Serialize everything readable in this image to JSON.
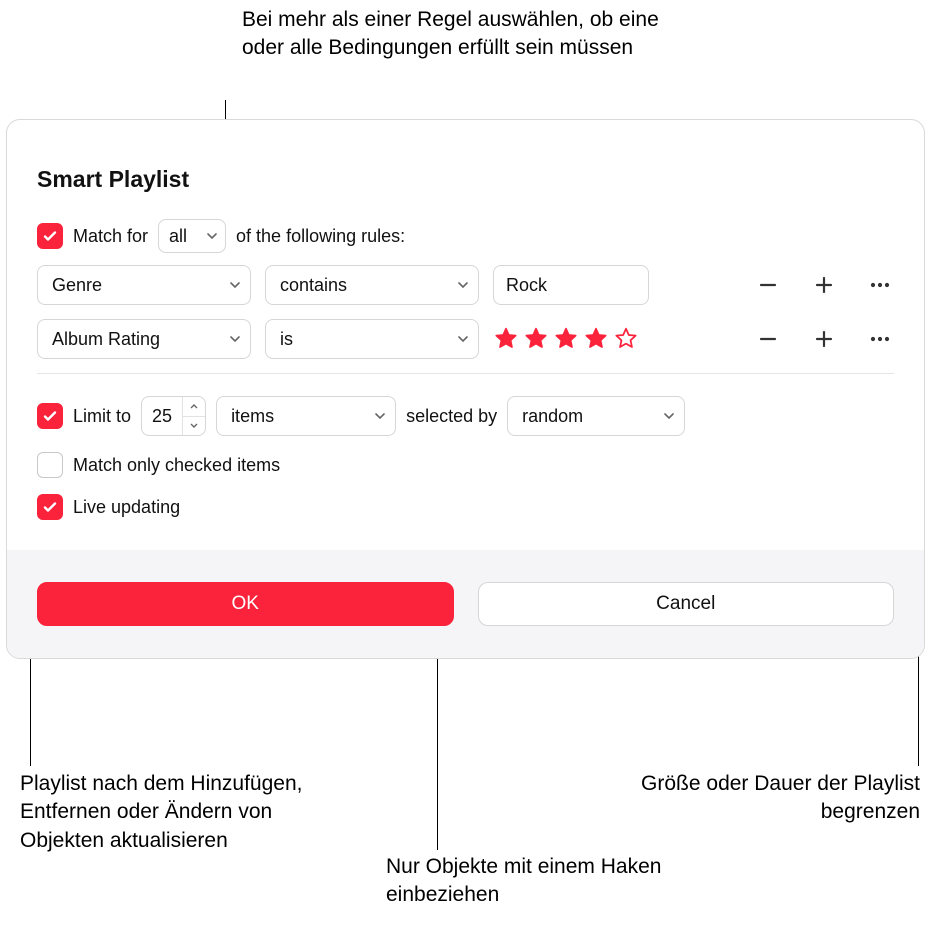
{
  "callouts": {
    "top": "Bei mehr als einer Regel auswählen, ob eine oder alle Bedingungen erfüllt sein müssen",
    "bottom_left": "Playlist nach dem Hinzufügen, Entfernen oder Ändern von Objekten aktualisieren",
    "bottom_mid": "Nur Objekte mit einem Haken einbeziehen",
    "bottom_right": "Größe oder Dauer der Playlist begrenzen"
  },
  "dialog": {
    "title": "Smart Playlist",
    "match": {
      "prefix": "Match for",
      "mode": "all",
      "suffix": "of the following rules:"
    },
    "rules": [
      {
        "field": "Genre",
        "op": "contains",
        "value": "Rock",
        "kind": "text"
      },
      {
        "field": "Album Rating",
        "op": "is",
        "stars_filled": 4,
        "stars_total": 5,
        "kind": "stars"
      }
    ],
    "limit": {
      "label": "Limit to",
      "value": "25",
      "unit": "items",
      "selected_by_label": "selected by",
      "selected_by_value": "random"
    },
    "match_only_checked": {
      "label": "Match only checked items",
      "checked": false
    },
    "live_updating": {
      "label": "Live updating",
      "checked": true
    },
    "buttons": {
      "ok": "OK",
      "cancel": "Cancel"
    }
  }
}
